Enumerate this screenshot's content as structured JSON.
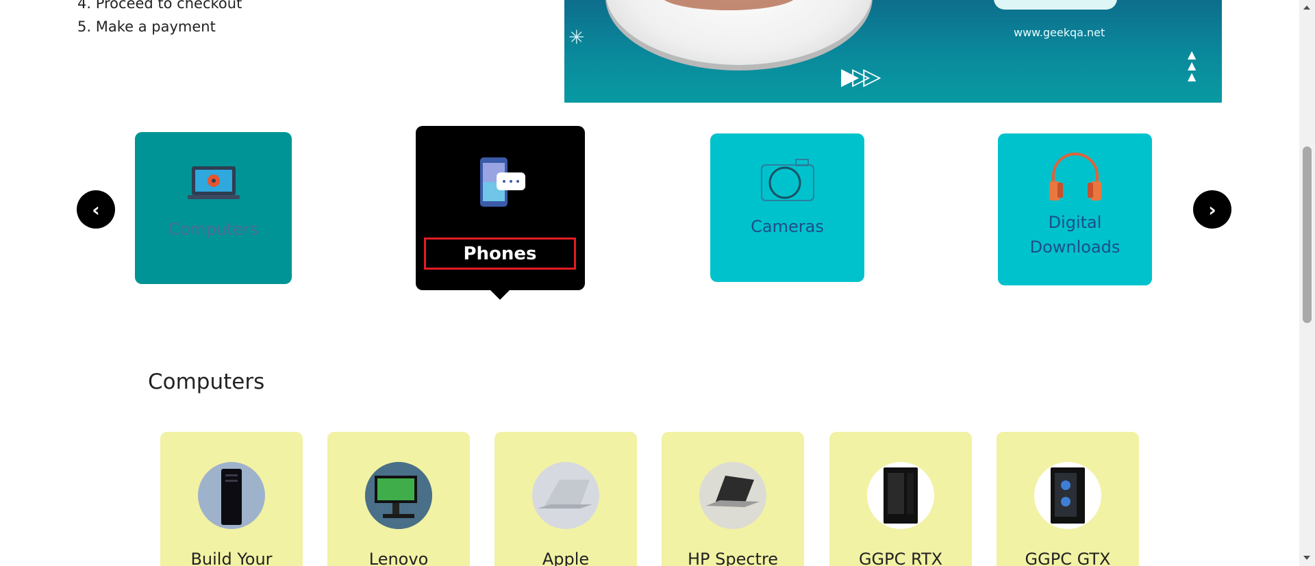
{
  "steps": {
    "step4": "4. Proceed to checkout",
    "step5": "5. Make a payment"
  },
  "banner": {
    "url_text": "www.geekqa.net"
  },
  "carousel": {
    "prev_label": "‹",
    "next_label": "›",
    "categories": [
      {
        "label": "Computers",
        "icon": "laptop-icon"
      },
      {
        "label": "Phones",
        "icon": "smartphone-icon"
      },
      {
        "label": "Cameras",
        "icon": "camera-icon"
      },
      {
        "label": "Digital Downloads",
        "label_lines": [
          "Digital",
          "Downloads"
        ],
        "icon": "headphones-icon"
      }
    ],
    "selected_index": 1
  },
  "section": {
    "title": "Computers",
    "products": [
      {
        "name": "Build Your"
      },
      {
        "name": "Lenovo"
      },
      {
        "name": "Apple"
      },
      {
        "name": "HP Spectre"
      },
      {
        "name": "GGPC RTX"
      },
      {
        "name": "GGPC GTX"
      }
    ]
  },
  "colors": {
    "teal_dark": "#009496",
    "teal_light": "#00c2cc",
    "card_yellow": "#f1f2a4",
    "highlight_red": "#e31b23",
    "label_blue": "#1d4e89"
  }
}
